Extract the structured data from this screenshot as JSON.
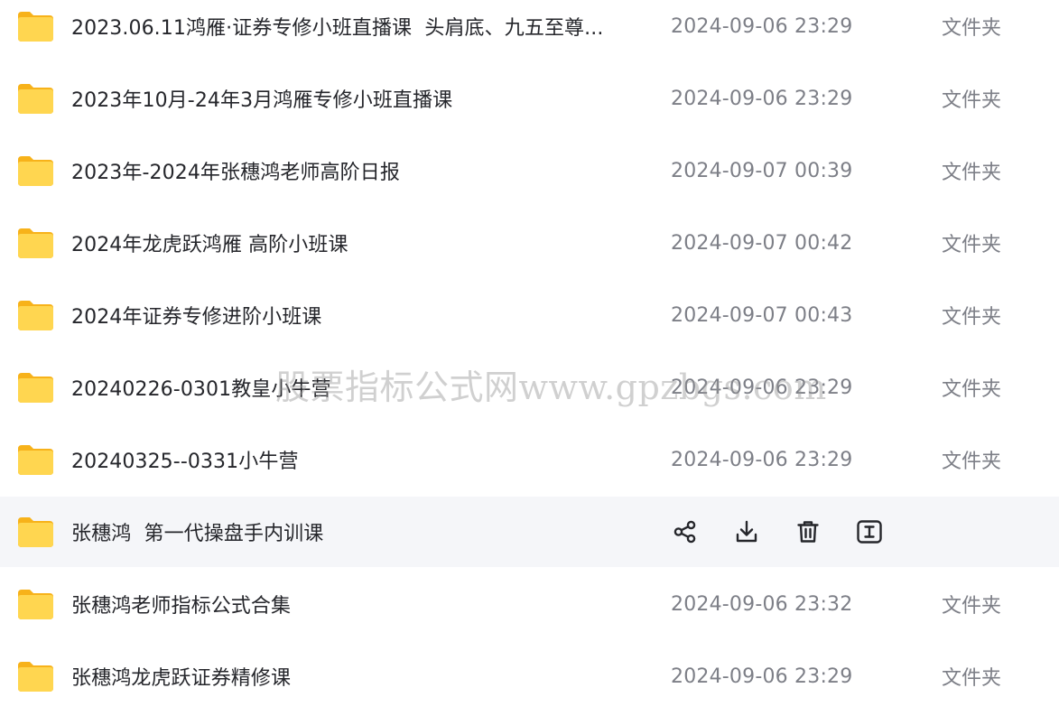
{
  "files": [
    {
      "name": "2023.06.11鸿雁·证券专修小班直播课  头肩底、九五至尊...",
      "date": "2024-09-06 23:29",
      "type": "文件夹"
    },
    {
      "name": "2023年10月-24年3月鸿雁专修小班直播课",
      "date": "2024-09-06 23:29",
      "type": "文件夹"
    },
    {
      "name": "2023年-2024年张穗鸿老师高阶日报",
      "date": "2024-09-07 00:39",
      "type": "文件夹"
    },
    {
      "name": "2024年龙虎跃鸿雁 高阶小班课",
      "date": "2024-09-07 00:42",
      "type": "文件夹"
    },
    {
      "name": "2024年证券专修进阶小班课",
      "date": "2024-09-07 00:43",
      "type": "文件夹"
    },
    {
      "name": "20240226-0301教皇小牛营",
      "date": "2024-09-06 23:29",
      "type": "文件夹"
    },
    {
      "name": "20240325--0331小牛营",
      "date": "2024-09-06 23:29",
      "type": "文件夹"
    },
    {
      "name": "张穗鸿  第一代操盘手内训课",
      "date": "",
      "type": ""
    },
    {
      "name": "张穗鸿老师指标公式合集",
      "date": "2024-09-06 23:32",
      "type": "文件夹"
    },
    {
      "name": "张穗鸿龙虎跃证券精修课",
      "date": "2024-09-06 23:29",
      "type": "文件夹"
    }
  ],
  "hovered_row": {
    "index": 7,
    "actions": [
      {
        "icon": "share-icon"
      },
      {
        "icon": "download-icon"
      },
      {
        "icon": "trash-icon"
      },
      {
        "icon": "rename-icon"
      }
    ]
  },
  "watermark": "股票指标公式网www.gpzbgs.com",
  "colors": {
    "folder": "#fdc21e",
    "folder_light": "#ffd650",
    "date_text": "#7d7f87",
    "name_text": "#25262b",
    "hover_bg": "#f5f6f9"
  }
}
